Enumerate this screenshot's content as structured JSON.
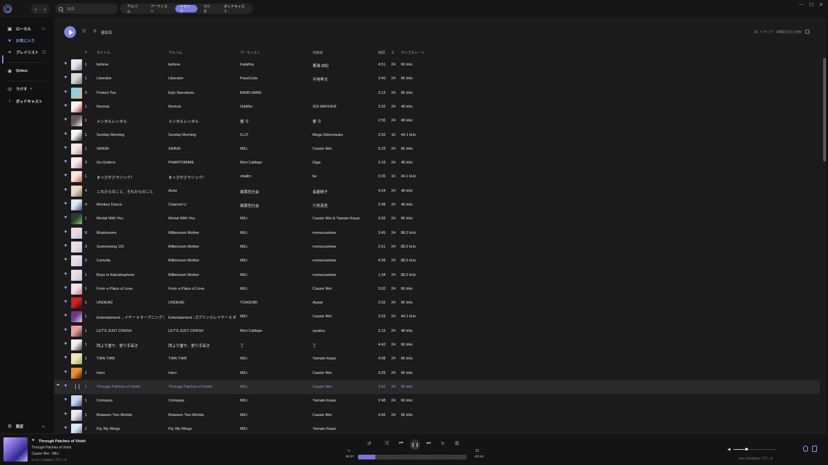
{
  "titlebar": {
    "search_placeholder": "検索",
    "tabs": [
      {
        "label": "アルバム",
        "active": false
      },
      {
        "label": "アーティスト",
        "active": false
      },
      {
        "label": "トラック",
        "active": true
      },
      {
        "label": "ラジオ",
        "active": false
      },
      {
        "label": "ポッドキャスト",
        "active": false
      }
    ],
    "window_controls": [
      "—",
      "☐",
      "✕"
    ]
  },
  "sidebar": {
    "local": "ローカル",
    "favorites": "お気に入り",
    "playlists": "プレイリスト",
    "qobuz": "Qobuz",
    "radio": "ラジオ",
    "radio_add": "+",
    "podcasts": "ポッドキャスト",
    "settings": "設定"
  },
  "toolbar": {
    "sort_label": "追加日",
    "summary": "93 トラック - 6時間 50分 24秒"
  },
  "columns": {
    "num": "#",
    "title": "タイトル",
    "album": "アルバム",
    "artist": "アーティスト",
    "composer": "作曲家",
    "time": "時間",
    "bits": "ビ",
    "rate": "サンプルレート"
  },
  "accent_color": "#8383ec",
  "tracks": [
    {
      "n": "1",
      "title": "believe",
      "album": "believe",
      "artist": "Kalafina",
      "composer": "梶浦 由記",
      "time": "4:51",
      "bits": "24",
      "rate": "96 kHz",
      "art": [
        "#e8e8f0",
        "#6a7fb0"
      ]
    },
    {
      "n": "1",
      "title": "Liberator",
      "album": "Liberator",
      "artist": "PassCode",
      "composer": "平地孝次",
      "time": "3:40",
      "bits": "24",
      "rate": "96 kHz",
      "art": [
        "#d9d9d9",
        "#7a6a6a"
      ]
    },
    {
      "n": "3",
      "title": "Protect You",
      "album": "Epic Narratives",
      "artist": "BAND-MAID",
      "composer": "",
      "time": "3:13",
      "bits": "24",
      "rate": "96 kHz",
      "art": [
        "#8fd0e8",
        "#e7b56a"
      ]
    },
    {
      "n": "1",
      "title": "Revival",
      "album": "Revival",
      "artist": "OddRe:",
      "composer": "SOI ANFIVER",
      "time": "3:32",
      "bits": "24",
      "rate": "48 kHz",
      "art": [
        "#f2f2f2",
        "#d02020"
      ]
    },
    {
      "n": "1",
      "title": "メンタルレンタル",
      "album": "メンタルレンタル",
      "artist": "紫 今",
      "composer": "紫 今",
      "time": "2:55",
      "bits": "24",
      "rate": "48 kHz",
      "art": [
        "#5a5a5a",
        "#e9e9e9"
      ]
    },
    {
      "n": "1",
      "title": "Sunday Morning",
      "album": "Sunday Morning",
      "artist": "ILLIT",
      "composer": "Mega Shinnosuke",
      "time": "2:52",
      "bits": "16",
      "rate": "44.1 kHz",
      "art": [
        "#f4f4f4",
        "#2a2a3a"
      ]
    },
    {
      "n": "1",
      "title": "SAIKAI",
      "album": "SAIKAI",
      "artist": "MILI",
      "composer": "Cassie Wei",
      "time": "5:23",
      "bits": "24",
      "rate": "96 kHz",
      "art": [
        "#f3e8e8",
        "#c98a8a"
      ]
    },
    {
      "n": "3",
      "title": "Go-Getters",
      "album": "PHANTOMIME",
      "artist": "Mori Calliope",
      "composer": "Giga",
      "time": "3:16",
      "bits": "24",
      "rate": "48 kHz",
      "art": [
        "#f0f0f0",
        "#e06a8a"
      ]
    },
    {
      "n": "1",
      "title": "まっさかさマジック！",
      "album": "まっさかさマジック！",
      "artist": "shallm",
      "composer": "lia",
      "time": "3:26",
      "bits": "16",
      "rate": "44.1 kHz",
      "art": [
        "#f8e8d8",
        "#c85a4a"
      ]
    },
    {
      "n": "4",
      "title": "これからのこと、それからのこと",
      "album": "Actor",
      "artist": "緑黄色社会",
      "composer": "長屋晴子",
      "time": "4:24",
      "bits": "24",
      "rate": "48 kHz",
      "art": [
        "#e8d8c8",
        "#8a6a4a"
      ]
    },
    {
      "n": "4",
      "title": "Monkey Dance",
      "album": "Channel U",
      "artist": "緑黄色社会",
      "composer": "穴見真吾",
      "time": "2:48",
      "bits": "24",
      "rate": "48 kHz",
      "art": [
        "#dfe8f4",
        "#3a4a7a"
      ]
    },
    {
      "n": "1",
      "title": "Mortal With You",
      "album": "Mortal With You",
      "artist": "MILI",
      "composer": "Cassie Wei & Yamato Kasai",
      "time": "3:55",
      "bits": "24",
      "rate": "96 kHz",
      "art": [
        "#2a3a2a",
        "#6ad06a"
      ]
    },
    {
      "n": "8",
      "title": "Mushrooms",
      "album": "Millennium Mother",
      "artist": "MILI",
      "composer": "momocashew",
      "time": "3:45",
      "bits": "24",
      "rate": "88.2 kHz",
      "art": [
        "#f0d8e8",
        "#a8c8e8"
      ]
    },
    {
      "n": "3",
      "title": "Summoning 101",
      "album": "Millennium Mother",
      "artist": "MILI",
      "composer": "momocashew",
      "time": "2:51",
      "bits": "24",
      "rate": "88.2 kHz",
      "art": [
        "#f0d8e8",
        "#a8c8e8"
      ]
    },
    {
      "n": "2",
      "title": "Camelia",
      "album": "Millennium Mother",
      "artist": "MILI",
      "composer": "momocashew",
      "time": "4:39",
      "bits": "24",
      "rate": "88.2 kHz",
      "art": [
        "#f0d8e8",
        "#a8c8e8"
      ]
    },
    {
      "n": "1",
      "title": "Boys in Kaleidosphere",
      "album": "Millennium Mother",
      "artist": "MILI",
      "composer": "momocashew",
      "time": "1:34",
      "bits": "24",
      "rate": "88.2 kHz",
      "art": [
        "#f0d8e8",
        "#a8c8e8"
      ]
    },
    {
      "n": "1",
      "title": "From a Place of Love",
      "album": "From a Place of Love",
      "artist": "MILI",
      "composer": "Cassie Wei",
      "time": "3:02",
      "bits": "24",
      "rate": "96 kHz",
      "art": [
        "#f4e0e8",
        "#d07890"
      ]
    },
    {
      "n": "1",
      "title": "UNDEAD",
      "album": "UNDEAD",
      "artist": "YOASOBI",
      "composer": "Ayase",
      "time": "3:02",
      "bits": "24",
      "rate": "96 kHz",
      "art": [
        "#d02020",
        "#3a0a0a"
      ]
    },
    {
      "n": "1",
      "title": "Entertainment ...イヤー II オープニングテーマ-",
      "album": "Entertainment -ゴブリンスレイヤー II オープ...",
      "artist": "MILI",
      "composer": "Cassie Wei",
      "time": "3:23",
      "bits": "24",
      "rate": "44.1 kHz",
      "art": [
        "#6a3a8a",
        "#e8c8f0"
      ]
    },
    {
      "n": "1",
      "title": "LET'S JUST CRASH",
      "album": "LET'S JUST CRASH",
      "artist": "Mori Calliope",
      "composer": "syudou",
      "time": "3:15",
      "bits": "24",
      "rate": "48 kHz",
      "art": [
        "#e8a0a0",
        "#4a2a2a"
      ]
    },
    {
      "n": "1",
      "title": "閃より雷や、更り乎高き",
      "album": "閃より雷や、更り乎高き",
      "artist": "丁",
      "composer": "丁",
      "time": "4:42",
      "bits": "24",
      "rate": "96 kHz",
      "art": [
        "#f0f0f0",
        "#3a3a3a"
      ]
    },
    {
      "n": "1",
      "title": "TIAN TIAN",
      "album": "TIAN TIAN",
      "artist": "MILI",
      "composer": "Yamato Kasai",
      "time": "4:08",
      "bits": "24",
      "rate": "96 kHz",
      "art": [
        "#f0e8b0",
        "#8ab06a"
      ]
    },
    {
      "n": "1",
      "title": "Hero",
      "album": "Hero",
      "artist": "MILI",
      "composer": "Cassie Wei",
      "time": "3:29",
      "bits": "24",
      "rate": "96 kHz",
      "art": [
        "#f09030",
        "#2a1a0a"
      ]
    },
    {
      "n": "1",
      "title": "Through Patches of Violet",
      "album": "Through Patches of Violet",
      "artist": "MILI",
      "composer": "Cassie Wei",
      "time": "3:52",
      "bits": "24",
      "rate": "96 kHz",
      "art": [
        "#2a2a2a",
        "#2a2a2a"
      ],
      "playing": true
    },
    {
      "n": "1",
      "title": "Compass",
      "album": "Compass",
      "artist": "MILI",
      "composer": "Yamato Kasai",
      "time": "2:48",
      "bits": "24",
      "rate": "96 kHz",
      "art": [
        "#c8d8f0",
        "#3a4a8a"
      ]
    },
    {
      "n": "1",
      "title": "Between Two Worlds",
      "album": "Between Two Worlds",
      "artist": "MILI",
      "composer": "Cassie Wei",
      "time": "4:56",
      "bits": "24",
      "rate": "96 kHz",
      "art": [
        "#e8e8f0",
        "#6a6a8a"
      ]
    },
    {
      "n": "1",
      "title": "Fly, My Wings",
      "album": "Fly, My Wings",
      "artist": "MILI",
      "composer": "Yamato Kasai",
      "time": "",
      "bits": "",
      "rate": "",
      "art": [
        "#d8e8f8",
        "#4a6a9a"
      ]
    }
  ],
  "now_playing": {
    "title": "Through Patches of Violet",
    "album": "Through Patches of Violet",
    "artist": "Cassie Wei - MILI",
    "format": "FLAC | 24/96kHz ステレオ",
    "elapsed": "00:37",
    "remaining": "-03:15",
    "progress": 0.16,
    "volume": 0.3,
    "dac": "DAC 32/192kHz ステレオ"
  }
}
